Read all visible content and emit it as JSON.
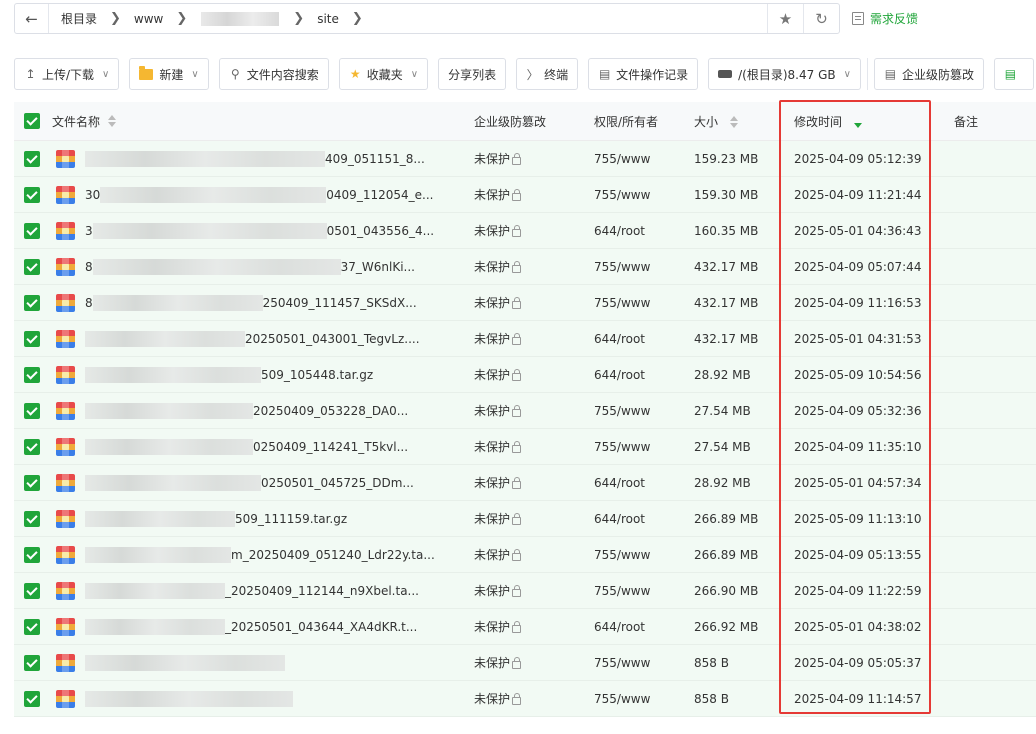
{
  "address_bar": {
    "crumbs": [
      "根目录",
      "www",
      "site"
    ]
  },
  "feedback_label": "需求反馈",
  "toolbar": {
    "upload_download": "上传/下载",
    "new": "新建",
    "content_search": "文件内容搜索",
    "favorites": "收藏夹",
    "share_list": "分享列表",
    "terminal": "终端",
    "op_log": "文件操作记录",
    "disk": "/(根目录)8.47 GB",
    "tamper_proof": "企业级防篡改"
  },
  "table": {
    "headers": {
      "name": "文件名称",
      "protection": "企业级防篡改",
      "perm_owner": "权限/所有者",
      "size": "大小",
      "mtime": "修改时间",
      "note": "备注"
    },
    "rows": [
      {
        "name_visible": "409_051151_8...",
        "protection": "未保护",
        "perm": "755/www",
        "size": "159.23 MB",
        "mtime": "2025-04-09 05:12:39"
      },
      {
        "name_visible": "30",
        "name_tail": "0409_112054_e...",
        "protection": "未保护",
        "perm": "755/www",
        "size": "159.30 MB",
        "mtime": "2025-04-09 11:21:44"
      },
      {
        "name_visible": "3",
        "name_tail": "0501_043556_4...",
        "protection": "未保护",
        "perm": "644/root",
        "size": "160.35 MB",
        "mtime": "2025-05-01 04:36:43"
      },
      {
        "name_visible": "8",
        "name_tail": "37_W6nlKi...",
        "protection": "未保护",
        "perm": "755/www",
        "size": "432.17 MB",
        "mtime": "2025-04-09 05:07:44"
      },
      {
        "name_visible": "8",
        "name_tail": "250409_111457_SKSdX...",
        "protection": "未保护",
        "perm": "755/www",
        "size": "432.17 MB",
        "mtime": "2025-04-09 11:16:53"
      },
      {
        "name_visible": "",
        "name_tail": "20250501_043001_TegvLz....",
        "protection": "未保护",
        "perm": "644/root",
        "size": "432.17 MB",
        "mtime": "2025-05-01 04:31:53"
      },
      {
        "name_visible": "",
        "name_tail": "509_105448.tar.gz",
        "protection": "未保护",
        "perm": "644/root",
        "size": "28.92 MB",
        "mtime": "2025-05-09 10:54:56"
      },
      {
        "name_visible": "",
        "name_tail": "20250409_053228_DA0...",
        "protection": "未保护",
        "perm": "755/www",
        "size": "27.54 MB",
        "mtime": "2025-04-09 05:32:36"
      },
      {
        "name_visible": "",
        "name_tail": "0250409_114241_T5kvl...",
        "protection": "未保护",
        "perm": "755/www",
        "size": "27.54 MB",
        "mtime": "2025-04-09 11:35:10"
      },
      {
        "name_visible": "",
        "name_tail": "0250501_045725_DDm...",
        "protection": "未保护",
        "perm": "644/root",
        "size": "28.92 MB",
        "mtime": "2025-05-01 04:57:34"
      },
      {
        "name_visible": "",
        "name_tail": "509_111159.tar.gz",
        "protection": "未保护",
        "perm": "644/root",
        "size": "266.89 MB",
        "mtime": "2025-05-09 11:13:10"
      },
      {
        "name_visible": "",
        "name_tail": "m_20250409_051240_Ldr22y.ta...",
        "protection": "未保护",
        "perm": "755/www",
        "size": "266.89 MB",
        "mtime": "2025-04-09 05:13:55"
      },
      {
        "name_visible": "",
        "name_tail": "_20250409_112144_n9Xbel.ta...",
        "protection": "未保护",
        "perm": "755/www",
        "size": "266.90 MB",
        "mtime": "2025-04-09 11:22:59"
      },
      {
        "name_visible": "",
        "name_tail": "_20250501_043644_XA4dKR.t...",
        "protection": "未保护",
        "perm": "644/root",
        "size": "266.92 MB",
        "mtime": "2025-05-01 04:38:02"
      },
      {
        "name_visible": "",
        "name_tail": "",
        "protection": "未保护",
        "perm": "755/www",
        "size": "858 B",
        "mtime": "2025-04-09 05:05:37"
      },
      {
        "name_visible": "",
        "name_tail": "",
        "protection": "未保护",
        "perm": "755/www",
        "size": "858 B",
        "mtime": "2025-04-09 11:14:57"
      }
    ]
  },
  "colors": {
    "accent": "#20a53a",
    "highlight_box": "#e53935",
    "row_bg": "#f2faf4"
  }
}
